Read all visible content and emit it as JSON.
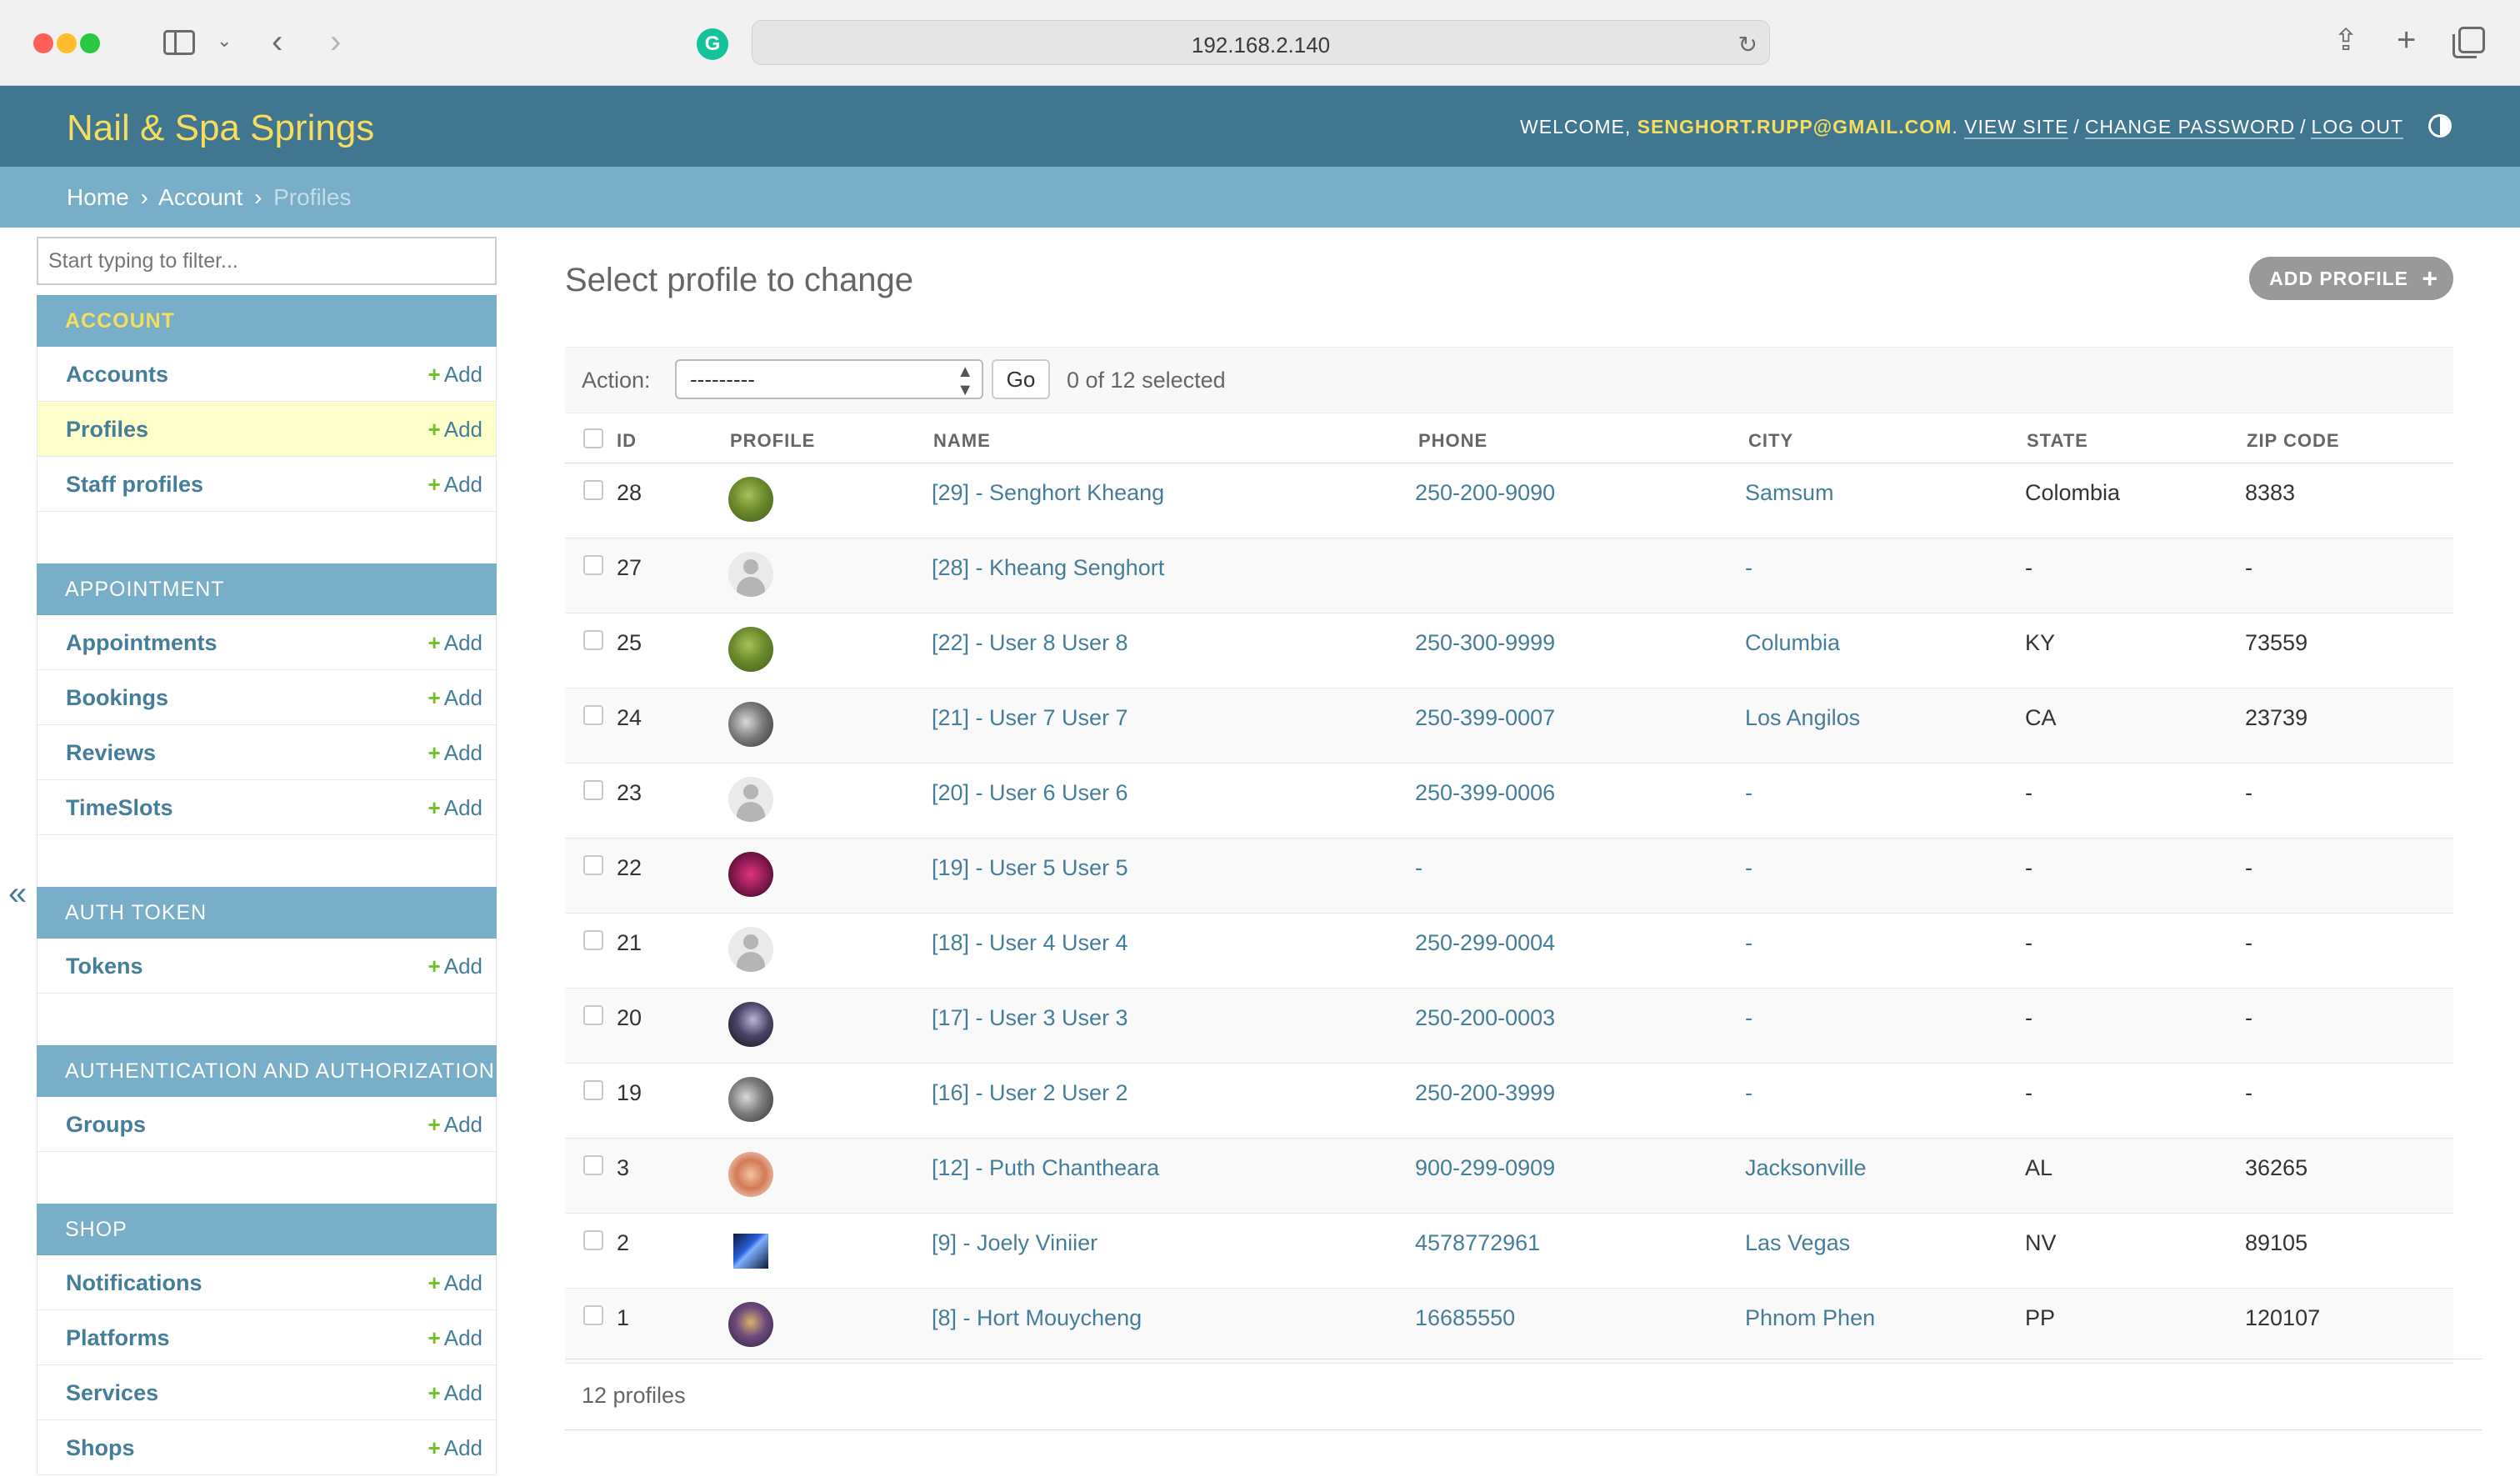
{
  "browser": {
    "url": "192.168.2.140"
  },
  "header": {
    "site_name": "Nail & Spa Springs",
    "welcome": "Welcome,",
    "username": "senghort.rupp@gmail.com",
    "view_site": "View site",
    "change_password": "Change password",
    "log_out": "Log out"
  },
  "breadcrumbs": {
    "home": "Home",
    "account": "Account",
    "current": "Profiles"
  },
  "sidebar": {
    "filter_placeholder": "Start typing to filter...",
    "add_label": "Add",
    "modules": [
      {
        "caption": "Account",
        "items": [
          "Accounts",
          "Profiles",
          "Staff profiles"
        ]
      },
      {
        "caption": "Appointment",
        "items": [
          "Appointments",
          "Bookings",
          "Reviews",
          "TimeSlots"
        ]
      },
      {
        "caption": "Auth Token",
        "items": [
          "Tokens"
        ]
      },
      {
        "caption": "Authentication and Authorization",
        "items": [
          "Groups"
        ]
      },
      {
        "caption": "Shop",
        "items": [
          "Notifications",
          "Platforms",
          "Services",
          "Shops"
        ]
      }
    ]
  },
  "content": {
    "title": "Select profile to change",
    "add_button": "Add profile",
    "action_label": "Action:",
    "action_value": "---------",
    "go_label": "Go",
    "counter": "0 of 12 selected",
    "columns": [
      "ID",
      "Profile",
      "Name",
      "Phone",
      "City",
      "State",
      "Zip code"
    ],
    "rows": [
      {
        "id": "28",
        "avatar": "green",
        "name": "[29] - Senghort Kheang",
        "phone": "250-200-9090",
        "city": "Samsum",
        "state": "Colombia",
        "zip": "8383"
      },
      {
        "id": "27",
        "avatar": "default",
        "name": "[28] - Kheang Senghort",
        "phone": "",
        "city": "-",
        "state": "-",
        "zip": "-"
      },
      {
        "id": "25",
        "avatar": "green",
        "name": "[22] - User 8 User 8",
        "phone": "250-300-9999",
        "city": "Columbia",
        "state": "KY",
        "zip": "73559"
      },
      {
        "id": "24",
        "avatar": "gray",
        "name": "[21] - User 7 User 7",
        "phone": "250-399-0007",
        "city": "Los Angilos",
        "state": "CA",
        "zip": "23739"
      },
      {
        "id": "23",
        "avatar": "default",
        "name": "[20] - User 6 User 6",
        "phone": "250-399-0006",
        "city": "-",
        "state": "-",
        "zip": "-"
      },
      {
        "id": "22",
        "avatar": "magenta",
        "name": "[19] - User 5 User 5",
        "phone": "-",
        "city": "-",
        "state": "-",
        "zip": "-"
      },
      {
        "id": "21",
        "avatar": "default",
        "name": "[18] - User 4 User 4",
        "phone": "250-299-0004",
        "city": "-",
        "state": "-",
        "zip": "-"
      },
      {
        "id": "20",
        "avatar": "dark",
        "name": "[17] - User 3 User 3",
        "phone": "250-200-0003",
        "city": "-",
        "state": "-",
        "zip": "-"
      },
      {
        "id": "19",
        "avatar": "gray",
        "name": "[16] - User 2 User 2",
        "phone": "250-200-3999",
        "city": "-",
        "state": "-",
        "zip": "-"
      },
      {
        "id": "3",
        "avatar": "peach",
        "name": "[12] - Puth Chantheara",
        "phone": "900-299-0909",
        "city": "Jacksonville",
        "state": "AL",
        "zip": "36265"
      },
      {
        "id": "2",
        "avatar": "screen",
        "name": "[9] - Joely Viniier",
        "phone": "4578772961",
        "city": "Las Vegas",
        "state": "NV",
        "zip": "89105"
      },
      {
        "id": "1",
        "avatar": "brown",
        "name": "[8] - Hort Mouycheng",
        "phone": "16685550",
        "city": "Phnom Phen",
        "state": "PP",
        "zip": "120107"
      }
    ],
    "paginator": "12 profiles"
  },
  "colors": {
    "header_bg": "#417690",
    "breadcrumb_bg": "#79aec8",
    "site_name": "#f5dd5d",
    "link": "#447e9b",
    "add_plus": "#70bf2b",
    "current_row": "#ffffcc"
  }
}
